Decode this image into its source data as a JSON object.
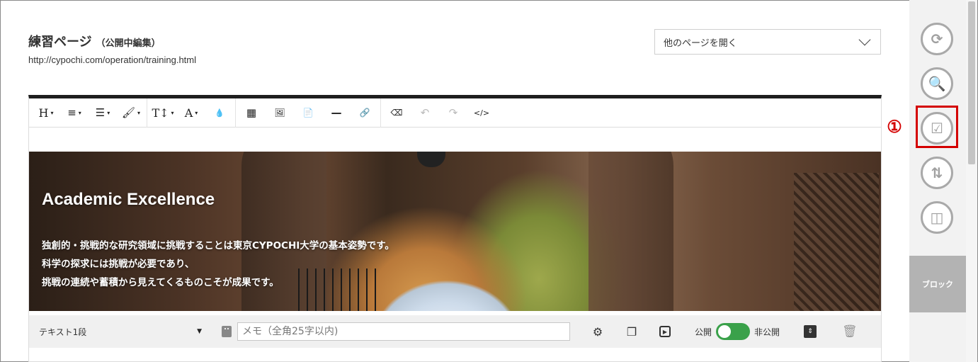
{
  "header": {
    "title": "練習ページ",
    "title_sub": "（公開中編集）",
    "url": "http://cypochi.com/operation/training.html",
    "page_select": "他のページを開く"
  },
  "toolbar": {
    "items": [
      {
        "name": "heading",
        "glyph": "H",
        "caret": "▾"
      },
      {
        "name": "align",
        "glyph": "≡",
        "caret": "▾"
      },
      {
        "name": "list",
        "glyph": "☰",
        "caret": "▾"
      },
      {
        "name": "brush",
        "glyph": "🖌",
        "caret": "▾"
      },
      {
        "name": "font-size",
        "glyph": "T↕",
        "caret": "▾"
      },
      {
        "name": "font-color",
        "glyph": "A",
        "caret": "▾"
      },
      {
        "name": "drop",
        "glyph": "💧"
      },
      {
        "name": "table",
        "glyph": "▦"
      },
      {
        "name": "image",
        "glyph": "🖼"
      },
      {
        "name": "file",
        "glyph": "📄"
      },
      {
        "name": "hr",
        "glyph": "—"
      },
      {
        "name": "link",
        "glyph": "🔗"
      },
      {
        "name": "eraser",
        "glyph": "⌫"
      },
      {
        "name": "undo",
        "glyph": "↶"
      },
      {
        "name": "redo",
        "glyph": "↷"
      },
      {
        "name": "code",
        "glyph": "</>"
      }
    ]
  },
  "hero": {
    "title": "Academic Excellence",
    "lines": [
      "独創的・挑戦的な研究領域に挑戦することは東京CYPOCHI大学の基本姿勢です。",
      "科学の探求には挑戦が必要であり、",
      "挑戦の連続や蓄積から見えてくるものこそが成果です。"
    ]
  },
  "blockbar": {
    "block_type": "テキスト1段",
    "memo_placeholder": "メモ（全角25字以内)",
    "public_label": "公開",
    "private_label": "非公開"
  },
  "rail": {
    "marker": "①",
    "block_label": "ブロック"
  },
  "colors": {
    "accent_red": "#d40000",
    "toggle_green": "#3aa14a",
    "rail_bg": "#f2f2f2"
  }
}
